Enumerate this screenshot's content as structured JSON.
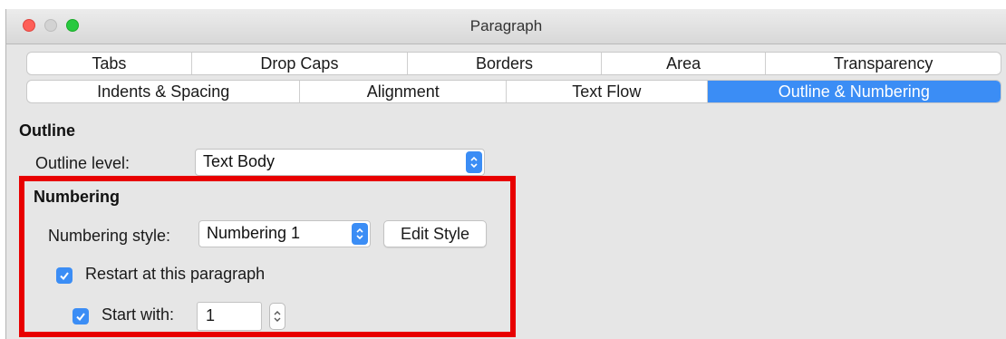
{
  "window": {
    "title": "Paragraph"
  },
  "tabs_row1": [
    {
      "label": "Tabs"
    },
    {
      "label": "Drop Caps"
    },
    {
      "label": "Borders"
    },
    {
      "label": "Area"
    },
    {
      "label": "Transparency"
    }
  ],
  "tabs_row2": [
    {
      "label": "Indents & Spacing"
    },
    {
      "label": "Alignment"
    },
    {
      "label": "Text Flow"
    },
    {
      "label": "Outline & Numbering",
      "selected": true
    }
  ],
  "outline": {
    "heading": "Outline",
    "level_label": "Outline level:",
    "level_value": "Text Body"
  },
  "numbering": {
    "heading": "Numbering",
    "style_label": "Numbering style:",
    "style_value": "Numbering 1",
    "edit_style_label": "Edit Style",
    "restart_label": "Restart at this paragraph",
    "restart_checked": true,
    "start_with_label": "Start with:",
    "start_with_checked": true,
    "start_with_value": "1"
  },
  "colors": {
    "accent": "#3b8df5",
    "highlight": "#e80000",
    "close": "#fe5f57",
    "maximize": "#27c93f"
  }
}
